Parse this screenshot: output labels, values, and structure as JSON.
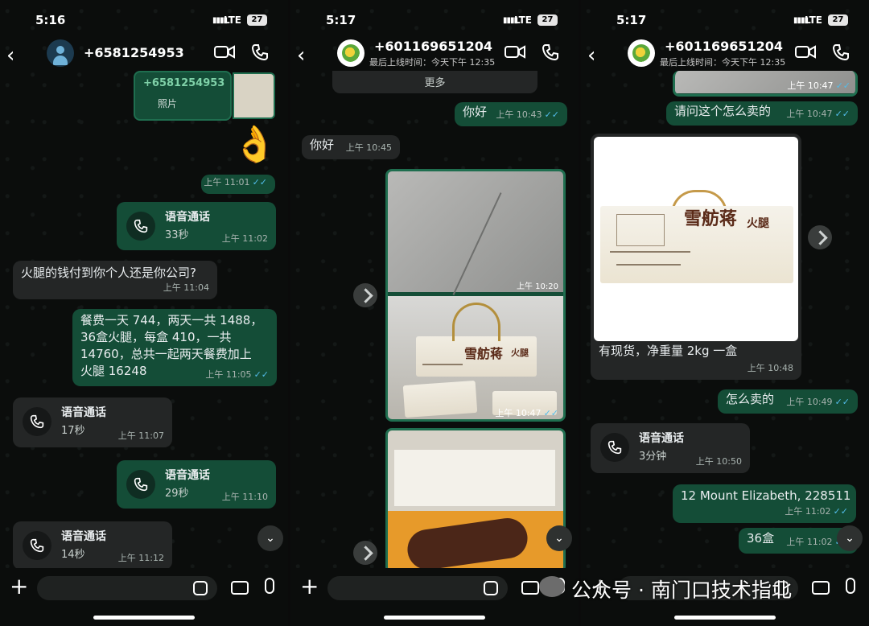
{
  "panel1": {
    "status": {
      "time": "5:16",
      "network": "LTE",
      "battery": "27"
    },
    "contact": {
      "name": "+6581254953"
    },
    "msgs": {
      "contact_card": {
        "name": "+6581254953",
        "label": "照片"
      },
      "emoji": "👌",
      "emoji_time": "上午 11:01",
      "call1": {
        "title": "语音通话",
        "duration": "33秒",
        "time": "上午 11:02"
      },
      "q": {
        "text": "火腿的钱付到你个人还是你公司?",
        "time": "上午 11:04"
      },
      "bill": {
        "line1": "餐费一天 744，两天一共 1488，",
        "line2": "36盒火腿，每盒 410，一共",
        "line3": "14760，总共一起两天餐费加上",
        "line4": "火腿 16248",
        "time": "上午 11:05"
      },
      "call2": {
        "title": "语音通话",
        "duration": "17秒",
        "time": "上午 11:07"
      },
      "call3": {
        "title": "语音通话",
        "duration": "29秒",
        "time": "上午 11:10"
      },
      "call4": {
        "title": "语音通话",
        "duration": "14秒",
        "time": "上午 11:12"
      }
    }
  },
  "panel2": {
    "status": {
      "time": "5:17",
      "network": "LTE",
      "battery": "27"
    },
    "contact": {
      "name": "+601169651204",
      "last_seen": "最后上线时间：今天下午 12:35"
    },
    "msgs": {
      "more": "更多",
      "hello_out": {
        "text": "你好",
        "time": "上午 10:43"
      },
      "hello_in": {
        "text": "你好",
        "time": "上午 10:45"
      },
      "img1_time": "上午 10:20",
      "img2_time": "上午 10:47",
      "brand": "雪舫蒋",
      "brand_sub": "火腿"
    }
  },
  "panel3": {
    "status": {
      "time": "5:17",
      "network": "LTE",
      "battery": "27"
    },
    "contact": {
      "name": "+601169651204",
      "last_seen": "最后上线时间：今天下午 12:35"
    },
    "msgs": {
      "top_img_time": "上午 10:47",
      "ask": {
        "text": "请问这个怎么卖的",
        "time": "上午 10:47"
      },
      "photo_caption": {
        "text": "有现货，净重量 2kg 一盒",
        "time": "上午 10:48"
      },
      "how": {
        "text": "怎么卖的",
        "time": "上午 10:49"
      },
      "call": {
        "title": "语音通话",
        "duration": "3分钟",
        "time": "上午 10:50"
      },
      "addr": {
        "text": "12 Mount Elizabeth, 228511",
        "time": "上午 11:02"
      },
      "qty": {
        "text": "36盒",
        "time": "上午 11:02"
      },
      "brand": "雪舫蒋",
      "brand_sub": "火腿"
    }
  },
  "watermark": "公众号 · 南门口技术指北",
  "colors": {
    "outgoing": "#144d37",
    "incoming": "#242626",
    "tick": "#53bdeb"
  }
}
